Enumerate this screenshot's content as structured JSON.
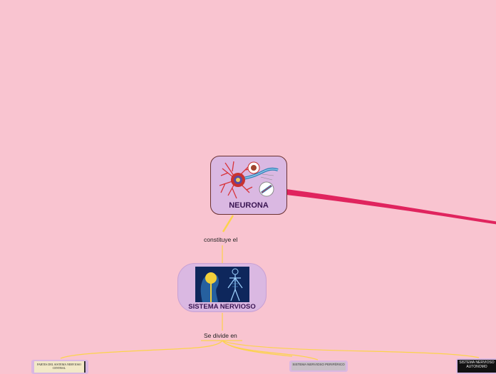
{
  "colors": {
    "background": "#f9c4d0",
    "node_fill": "#dab8e2",
    "connector_main": "#e0245e",
    "connector_branch": "#fcd34a"
  },
  "nodes": {
    "neurona": {
      "title": "NEURONA",
      "image": "neuron-illustration"
    },
    "sistema_nervioso": {
      "title": "SISTEMA NERVIOSO",
      "image": "human-nervous-system-illustration"
    },
    "partes": {
      "text": "PARTES DEL SISTEMA NERVIOSO CENTRAL"
    },
    "periferico": {
      "text": "SISTEMA NERVIOSO PERIFÉRICO"
    },
    "autonomo": {
      "text": "SISTEMA NERVIOSO AUTONOMO"
    }
  },
  "links": {
    "neurona_to_sistema": "constituye el",
    "sistema_to_branches": "Se divide en"
  }
}
